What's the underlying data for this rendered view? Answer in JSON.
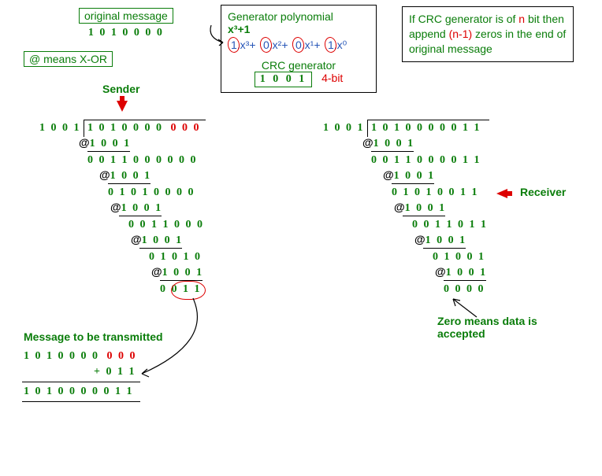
{
  "header": {
    "original_message_label": "original message",
    "original_message_bits": "1 0 1 0 0 0 0",
    "xor_note": "@ means X-OR",
    "generator_poly_label": "Generator polynomial",
    "generator_poly_expr": "x³+1",
    "generator_poly_expanded_bits": [
      "1",
      "0",
      "0",
      "1"
    ],
    "generator_poly_expanded_terms": [
      ".x³+",
      ".x²+",
      ".x¹+",
      ".x⁰"
    ],
    "crc_gen_label": "CRC generator",
    "crc_gen_bits": "1 0 0 1",
    "crc_gen_bitcount": "4-bit",
    "append_rule_pre": "If CRC generator is of ",
    "append_rule_n": "n",
    "append_rule_mid": " bit then append ",
    "append_rule_n1": "(n-1)",
    "append_rule_post": " zeros in the end of original message"
  },
  "sender": {
    "label": "Sender",
    "divisor": "1 0 0 1",
    "dividend_main": "1 0 1 0 0 0 0",
    "dividend_pad": "0 0 0",
    "steps": [
      {
        "xor": "1 0 0 1"
      },
      {
        "line": "0 0 1 1 0 0 0 0 0 0",
        "xor": "1 0 0 1"
      },
      {
        "line": "0 1 0 1 0 0 0 0",
        "xor": "1 0 0 1"
      },
      {
        "line": "0 0 1 1 0 0 0",
        "xor": "1 0 0 1"
      },
      {
        "line": "0 1 0 1 0",
        "xor": "1 0 0 1"
      },
      {
        "remainder": "0 0 1 1"
      }
    ],
    "remainder_tail": "0 1 1",
    "tx_label": "Message to be transmitted",
    "tx_line1_main": "1 0 1 0 0 0 0",
    "tx_line1_pad": "0 0 0",
    "tx_line2": "+ 0 1 1",
    "tx_result": "1 0 1 0 0 0 0 0 1 1"
  },
  "receiver": {
    "divisor": "1 0 0 1",
    "dividend": "1 0 1 0 0 0 0 0 1 1",
    "label": "Receiver",
    "steps": [
      {
        "xor": "1 0 0 1"
      },
      {
        "line": "0 0 1 1 0 0 0 0 1 1",
        "xor": "1 0 0 1"
      },
      {
        "line": "0 1 0 1 0 0 1 1",
        "xor": "1 0 0 1"
      },
      {
        "line": "0 0 1 1 0 1 1",
        "xor": "1 0 0 1"
      },
      {
        "line": "0 1 0 0 1",
        "xor": "1 0 0 1"
      },
      {
        "remainder": "0 0 0 0"
      }
    ],
    "zero_note": "Zero means data is accepted"
  }
}
